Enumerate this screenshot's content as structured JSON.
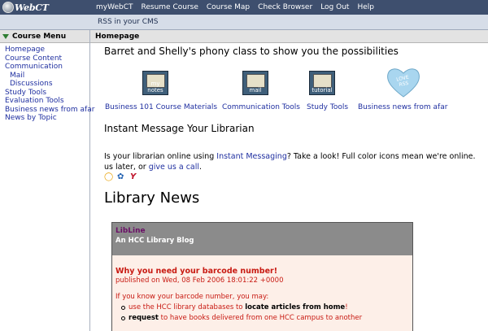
{
  "app": {
    "logo_text": "WebCT"
  },
  "topnav": [
    "myWebCT",
    "Resume Course",
    "Course Map",
    "Check Browser",
    "Log Out",
    "Help"
  ],
  "titlebar": "RSS in your CMS",
  "sidebar": {
    "header": "Course Menu",
    "items": [
      {
        "label": "Homepage",
        "sub": false
      },
      {
        "label": "Course Content",
        "sub": false
      },
      {
        "label": "Communication",
        "sub": false
      },
      {
        "label": "Mail",
        "sub": true
      },
      {
        "label": "Discussions",
        "sub": true
      },
      {
        "label": "Study Tools",
        "sub": false
      },
      {
        "label": "Evaluation Tools",
        "sub": false
      },
      {
        "label": "Business news from afar",
        "sub": false
      },
      {
        "label": "News by Topic",
        "sub": false
      }
    ]
  },
  "main": {
    "header": "Homepage",
    "course_title": "Barret and Shelly's phony class to show you the possibilities",
    "icons": [
      {
        "tile": "my notes",
        "caption": "Business 101 Course Materials"
      },
      {
        "tile": "mail",
        "caption": "Communication Tools"
      },
      {
        "tile": "tutorial",
        "caption": "Study Tools"
      },
      {
        "tile": "LOVE RSS",
        "caption": "Business news from afar"
      }
    ],
    "im_heading": "Instant Message Your Librarian",
    "im_line1_a": "Is your librarian online using ",
    "im_link1": "Instant Messaging",
    "im_line1_b": "? Take a look! Full color icons mean we're online. ",
    "im_line2_a": "us later, or ",
    "im_link2": "give us a call",
    "im_line2_b": ".",
    "library_news": "Library News",
    "blog": {
      "name": "LibLine",
      "desc": "An HCC Library Blog",
      "post_title": "Why you need your barcode number!",
      "post_date": "published on Wed, 08 Feb 2006 18:01:22 +0000",
      "intro": "If you know your barcode number, you may:",
      "bullet1_a": "use the HCC library databases to ",
      "bullet1_b": "locate articles from home",
      "bullet1_c": "!",
      "bullet2_a": "request",
      "bullet2_b": " to have books delivered from one HCC campus to another"
    }
  },
  "colors": {
    "topbar": "#3e4f6e",
    "link": "#1f2fa0",
    "blog_red": "#c81a12",
    "blog_head": "#8b8b8b"
  }
}
